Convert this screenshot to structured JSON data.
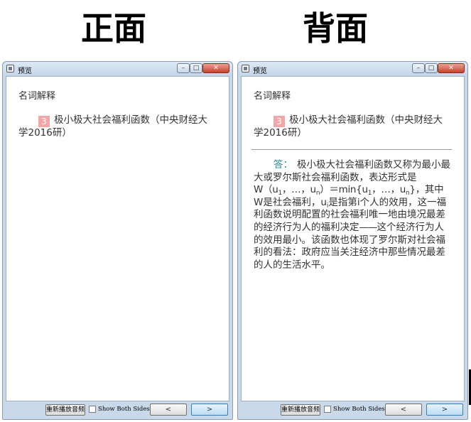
{
  "titles": {
    "front": "正面",
    "back": "背面"
  },
  "window": {
    "title": "预览",
    "min_glyph": "–",
    "max_glyph": "□",
    "close_glyph": "✕"
  },
  "card": {
    "section": "名词解释",
    "number": "3",
    "question_line1": "极小极大社会福利函数（中央财经大",
    "question_line2": "学2016研）",
    "answer_label": "答：",
    "answer_lines": {
      "l1_rest": "极小极大社会福利函数又称为最小最",
      "l2": "大或罗尔斯社会福利函数，表达形式是",
      "l3_a": "W（u",
      "l3_sub1": "1",
      "l3_b": "，…，u",
      "l3_sub2": "n",
      "l3_c": "）＝min{u",
      "l3_sub3": "1",
      "l3_d": "，…，u",
      "l3_sub4": "n",
      "l3_e": "}，其中",
      "l4_a": "W是社会福利，u",
      "l4_sub": "i",
      "l4_b": "是指第i个人的效用，这一福",
      "l5": "利函数说明配置的社会福利唯一地由境况最差",
      "l6_a": "的经济行为人的福利决定",
      "l6_dash": "——",
      "l6_b": "这个经济行为人",
      "l7": "的效用最小。该函数也体现了罗尔斯对社会福",
      "l8": "利的看法：政府应当关注经济中那些情况最差",
      "l9": "的人的生活水平。"
    }
  },
  "bottom": {
    "replay_label": "重新播放音频",
    "show_both_label": "Show Both Sides",
    "prev_glyph": "<",
    "next_glyph": ">"
  }
}
